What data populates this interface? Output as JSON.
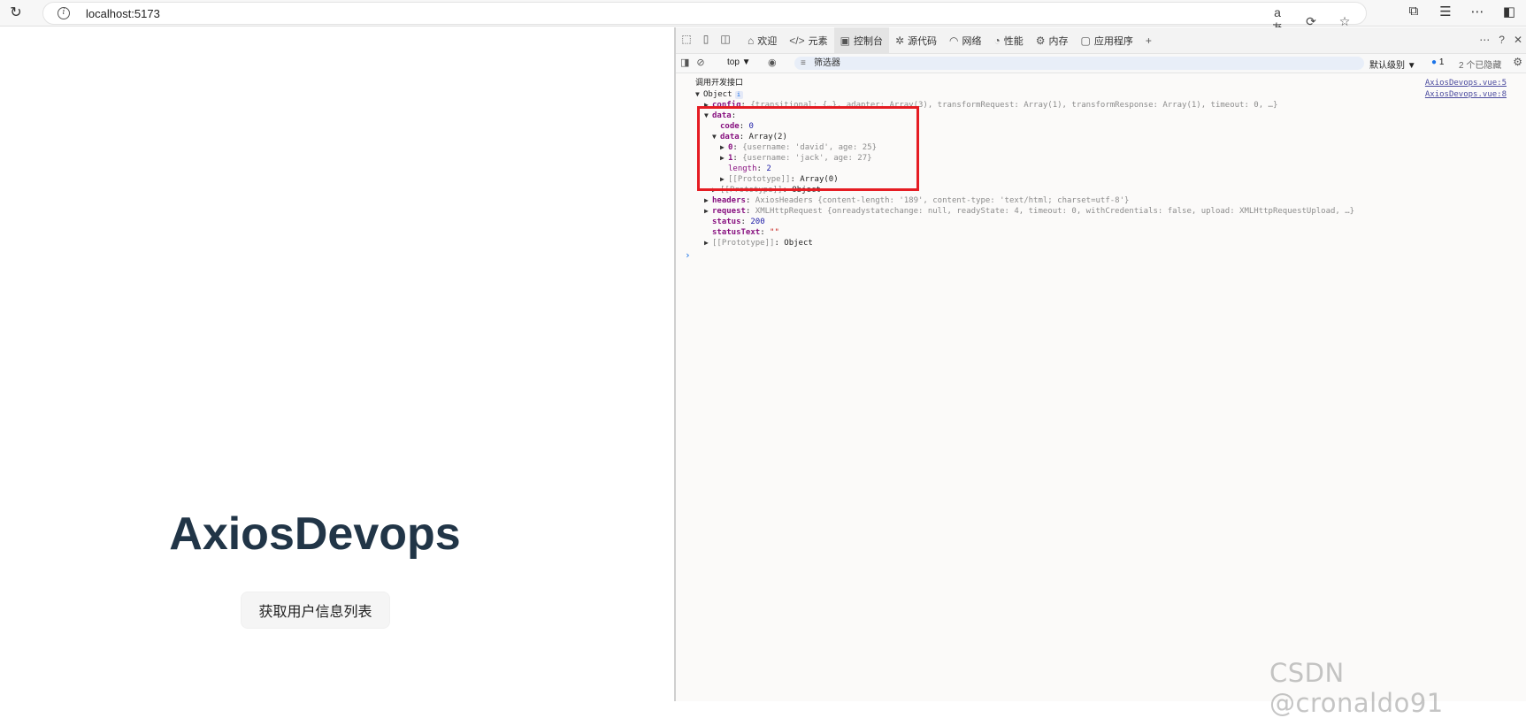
{
  "browser": {
    "url": "localhost:5173",
    "icons": [
      "refresh-icon",
      "info-icon",
      "read-aloud-icon",
      "sync-icon",
      "favorite-star-icon",
      "extensions-icon",
      "favorites-icon",
      "more-icon",
      "sidebar-icon"
    ]
  },
  "app": {
    "title": "AxiosDevops",
    "button_label": "获取用户信息列表"
  },
  "devtools": {
    "tabs": [
      {
        "label": "欢迎",
        "icon": "home-icon"
      },
      {
        "label": "元素",
        "icon": "code-icon"
      },
      {
        "label": "控制台",
        "icon": "console-icon"
      },
      {
        "label": "源代码",
        "icon": "bug-icon"
      },
      {
        "label": "网络",
        "icon": "wifi-icon"
      },
      {
        "label": "性能",
        "icon": "gauge-icon"
      },
      {
        "label": "内存",
        "icon": "gear-icon"
      },
      {
        "label": "应用程序",
        "icon": "window-icon"
      }
    ],
    "active_tab": "控制台",
    "add_tab": "+",
    "context": "top",
    "filter_placeholder": "筛选器",
    "level": "默认级别",
    "issues_count": "1",
    "hidden_text": "2 个已隐藏"
  },
  "console": {
    "line1_text": "调用开发接口",
    "line1_src": "AxiosDevops.vue:5",
    "line2_text": "Object",
    "line2_src": "AxiosDevops.vue:8",
    "config_key": "config",
    "config_val": "{transitional: {…}, adapter: Array(3), transformRequest: Array(1), transformResponse: Array(1), timeout: 0, …}",
    "data_key": "data",
    "code_key": "code",
    "code_val": "0",
    "inner_data_key": "data",
    "inner_data_val": "Array(2)",
    "item0_key": "0",
    "item0_val": "{username: 'david', age: 25}",
    "item1_key": "1",
    "item1_val": "{username: 'jack', age: 27}",
    "length_key": "length",
    "length_val": "2",
    "proto_array_key": "[[Prototype]]",
    "proto_array_val": "Array(0)",
    "proto_obj_key": "[[Prototype]]",
    "proto_obj_val": "Object",
    "headers_key": "headers",
    "headers_val": "AxiosHeaders {content-length: '189', content-type: 'text/html; charset=utf-8'}",
    "request_key": "request",
    "request_val": "XMLHttpRequest {onreadystatechange: null, readyState: 4, timeout: 0, withCredentials: false, upload: XMLHttpRequestUpload, …}",
    "status_key": "status",
    "status_val": "200",
    "statustext_key": "statusText",
    "statustext_val": "\"\"",
    "proto_top_key": "[[Prototype]]",
    "proto_top_val": "Object"
  },
  "watermark": "CSDN @cronaldo91",
  "colors": {
    "highlight": "#e51c23",
    "app_title": "#213547",
    "link": "#4a4a9e"
  }
}
